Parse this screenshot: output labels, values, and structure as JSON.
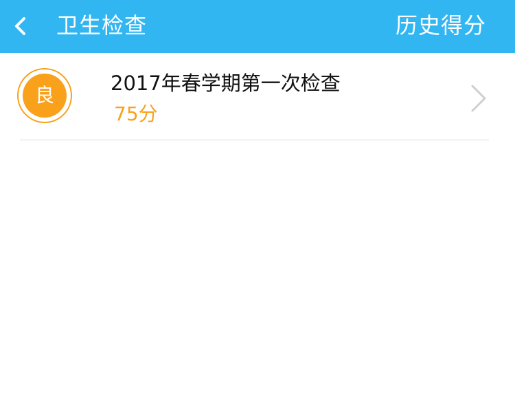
{
  "header": {
    "title": "卫生检查",
    "history_label": "历史得分"
  },
  "inspections": [
    {
      "grade": "良",
      "title": "2017年春学期第一次检查",
      "score": "75分"
    }
  ],
  "colors": {
    "header_bg": "#32b6f2",
    "accent_orange": "#f9a11b",
    "divider": "#dcdcdc",
    "chevron": "#cfcfcf"
  },
  "icons": {
    "back": "chevron-left-icon",
    "row_arrow": "chevron-right-icon"
  }
}
